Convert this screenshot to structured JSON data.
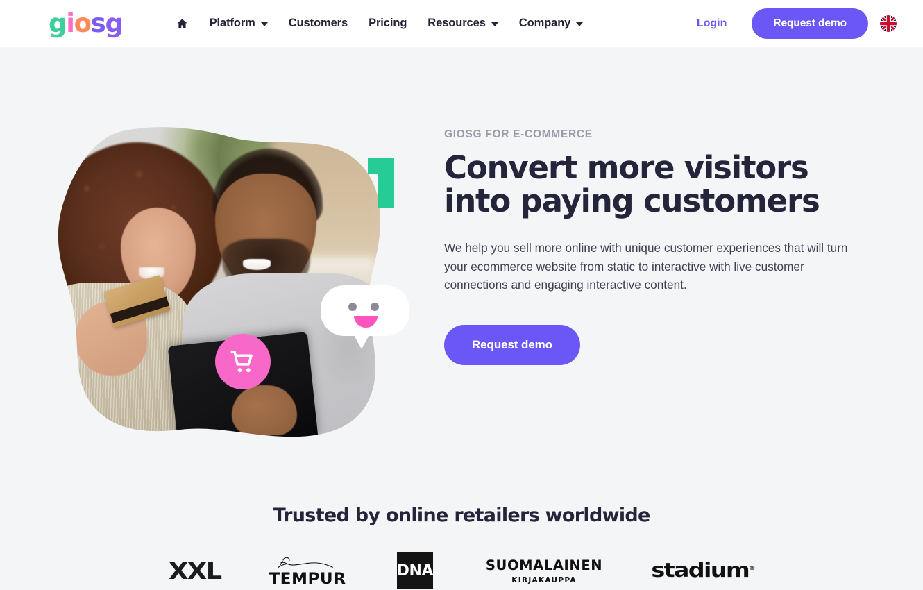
{
  "brand": {
    "logo_text": "giosg",
    "logo_letters": [
      "g",
      "i",
      "o",
      "s",
      "g"
    ],
    "colors": {
      "accent_purple": "#6b57f5",
      "accent_pink": "#f768c8",
      "accent_green": "#26cb96",
      "heading_navy": "#24243a",
      "page_bg": "#f4f5f7",
      "header_bg": "#ffffff"
    }
  },
  "header": {
    "nav": [
      {
        "label": "",
        "icon": "home-icon",
        "has_dropdown": false
      },
      {
        "label": "Platform",
        "icon": "",
        "has_dropdown": true
      },
      {
        "label": "Customers",
        "icon": "",
        "has_dropdown": false
      },
      {
        "label": "Pricing",
        "icon": "",
        "has_dropdown": false
      },
      {
        "label": "Resources",
        "icon": "",
        "has_dropdown": true
      },
      {
        "label": "Company",
        "icon": "",
        "has_dropdown": true
      }
    ],
    "login_label": "Login",
    "demo_label": "Request demo",
    "language_icon": "uk-flag-icon"
  },
  "hero": {
    "eyebrow": "GIOSG FOR E-COMMERCE",
    "title_line1": "Convert more visitors",
    "title_line2": "into paying customers",
    "description": "We help you sell more online with unique customer experiences that will turn your ecommerce website from static to interactive with live customer connections and engaging interactive content.",
    "cta_label": "Request demo",
    "media": {
      "photo_description": "Couple shopping online with a tablet and credit card",
      "badges": [
        {
          "name": "number-one-badge",
          "text": "1",
          "color": "#26cb96"
        },
        {
          "name": "chat-bubble-badge",
          "text": "",
          "color": "#ffffff"
        },
        {
          "name": "shopping-cart-badge",
          "text": "",
          "color": "#f768c8"
        }
      ]
    }
  },
  "trusted": {
    "title": "Trusted by online retailers worldwide",
    "logos": [
      {
        "name": "xxl",
        "text": "XXL"
      },
      {
        "name": "tempur",
        "text": "TEMPUR"
      },
      {
        "name": "dna",
        "text": "DNA"
      },
      {
        "name": "suomalainen",
        "text": "SUOMALAINEN",
        "subtext": "KIRJAKAUPPA"
      },
      {
        "name": "stadium",
        "text": "stadium",
        "mark": "®"
      }
    ]
  }
}
